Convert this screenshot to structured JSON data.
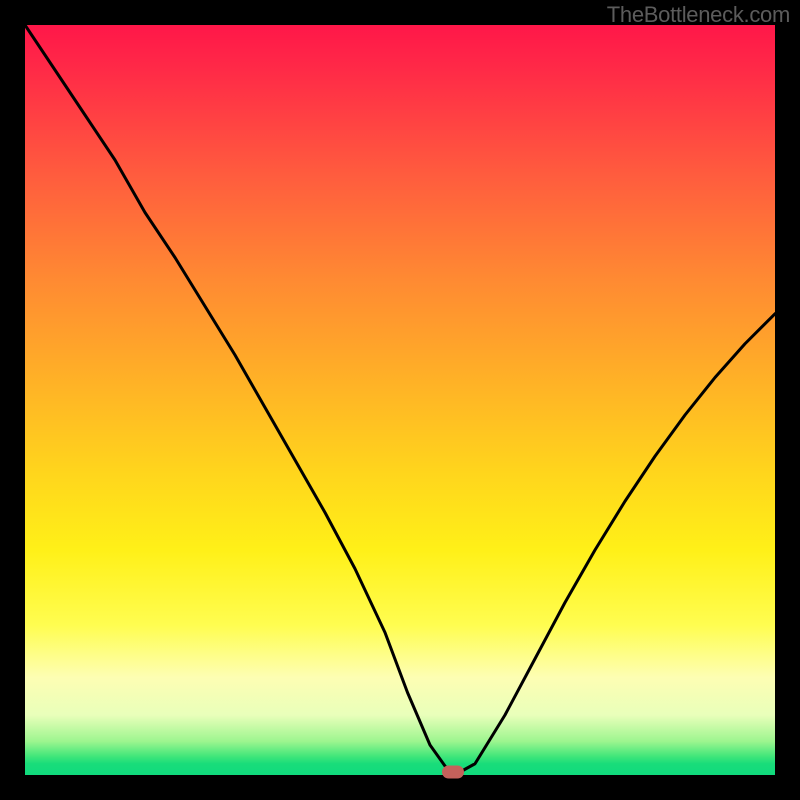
{
  "watermark": "TheBottleneck.com",
  "chart_data": {
    "type": "line",
    "title": "",
    "xlabel": "",
    "ylabel": "",
    "xlim": [
      0,
      100
    ],
    "ylim": [
      0,
      100
    ],
    "grid": false,
    "background_gradient": {
      "top": "#ff1749",
      "bottom": "#10da7d",
      "description": "vertical red-to-green heat gradient"
    },
    "series": [
      {
        "name": "bottleneck-curve",
        "color": "#000000",
        "x": [
          0,
          4,
          8,
          12,
          16,
          20,
          24,
          28,
          32,
          36,
          40,
          44,
          48,
          51,
          54,
          56.5,
          58,
          60,
          64,
          68,
          72,
          76,
          80,
          84,
          88,
          92,
          96,
          100
        ],
        "values": [
          100,
          94,
          88,
          82,
          75,
          69,
          62.5,
          56,
          49,
          42,
          35,
          27.5,
          19,
          11,
          4,
          0.5,
          0.4,
          1.5,
          8,
          15.5,
          23,
          30,
          36.5,
          42.5,
          48,
          53,
          57.5,
          61.5
        ]
      }
    ],
    "marker": {
      "name": "optimal-point",
      "x": 57,
      "y": 0.4,
      "color": "#c4615b"
    }
  }
}
